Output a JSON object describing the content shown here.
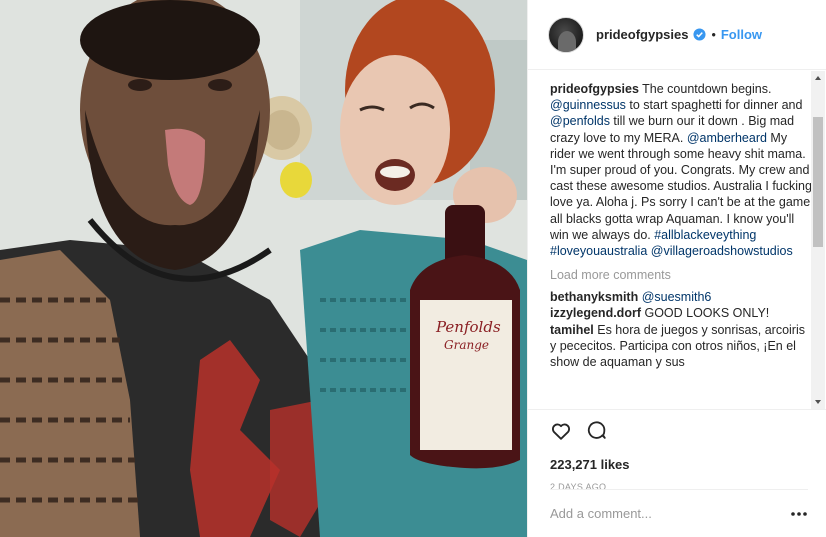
{
  "header": {
    "username": "prideofgypsies",
    "separator": "•",
    "follow_label": "Follow",
    "verified_icon": "verified-badge-icon"
  },
  "caption": {
    "username": "prideofgypsies",
    "parts": {
      "t1": " The countdown begins. ",
      "m1": "@guinnessus",
      "t2": " to start spaghetti for dinner and ",
      "m2": "@penfolds",
      "t3": " till we burn our it down . Big mad crazy love to my MERA. ",
      "m3": "@amberheard",
      "t4": " My rider we went through some heavy shit mama. I'm super proud of you. Congrats. My crew and cast these awesome studios. Australia I fucking love ya. Aloha j. Ps sorry I can't be at the game all blacks gotta wrap Aquaman. I know you'll win we always do. ",
      "h1": "#allblackeveything",
      "t5": " ",
      "h2": "#loveyouaustralia",
      "t6": " ",
      "m4": "@villageroadshowstudios"
    }
  },
  "load_more": "Load more comments",
  "comments": [
    {
      "username": "bethanyksmith",
      "text": "@suesmith6"
    },
    {
      "username": "izzylegend.dorf",
      "text": "GOOD LOOKS ONLY!"
    },
    {
      "username": "tamihel",
      "text": "Es hora de juegos y sonrisas, arcoiris y pececitos. Participa con otros niños, ¡En el show de aquaman y sus"
    }
  ],
  "actions": {
    "like_icon": "heart-icon",
    "comment_icon": "comment-bubble-icon",
    "likes": "223,271 likes",
    "date": "2 DAYS AGO"
  },
  "add_comment": {
    "placeholder": "Add a comment...",
    "more_icon": "more-options-icon"
  },
  "photo": {
    "bottle_label_line1": "Penfolds",
    "bottle_label_line2": "Grange"
  },
  "colors": {
    "link": "#003569",
    "follow": "#3897f0",
    "verified": "#3897f0",
    "muted": "#999999",
    "text": "#262626"
  }
}
